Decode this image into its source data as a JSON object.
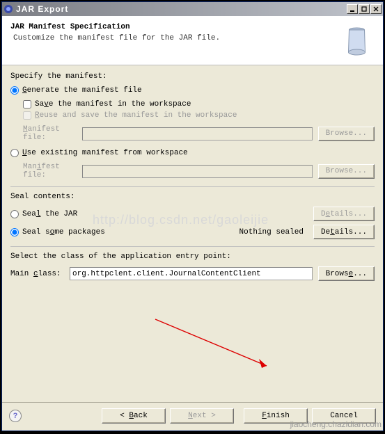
{
  "window": {
    "title": "JAR Export"
  },
  "header": {
    "title": "JAR Manifest Specification",
    "sub": "Customize the manifest file for the JAR file."
  },
  "manifest": {
    "section": "Specify the manifest:",
    "gen_radio": "Generate the manifest file",
    "save_check_pre": "Sa",
    "save_check_u": "v",
    "save_check_post": "e the manifest in the workspace",
    "reuse_check_pre": "",
    "reuse_check_u": "R",
    "reuse_check_post": "euse and save the manifest in the workspace",
    "file_label_pre": "",
    "file_label_u": "M",
    "file_label_post": "anifest file:",
    "browse": "Browse...",
    "use_radio_pre": "",
    "use_radio_u": "U",
    "use_radio_post": "se existing manifest from workspace",
    "file2_label_pre": "Man",
    "file2_label_u": "i",
    "file2_label_post": "fest file:"
  },
  "seal": {
    "section": "Seal contents:",
    "all_pre": "Sea",
    "all_u": "l",
    "all_post": " the JAR",
    "some_pre": "Seal s",
    "some_u": "o",
    "some_post": "me packages",
    "status": "Nothing sealed",
    "details_pre": "D",
    "details_u": "e",
    "details_post": "tails...",
    "details2_pre": "De",
    "details2_u": "t",
    "details2_post": "ails..."
  },
  "entry": {
    "section": "Select the class of the application entry point:",
    "label_pre": "Main ",
    "label_u": "c",
    "label_post": "lass:",
    "value": "org.httpclent.client.JournalContentClient",
    "browse_pre": "Brows",
    "browse_u": "e",
    "browse_post": "..."
  },
  "footer": {
    "back_pre": "< ",
    "back_u": "B",
    "back_post": "ack",
    "next_pre": "",
    "next_u": "N",
    "next_post": "ext >",
    "finish_pre": "",
    "finish_u": "F",
    "finish_post": "inish",
    "cancel": "Cancel"
  },
  "watermark": "http://blog.csdn.net/gaoleijie",
  "chart_data": null
}
